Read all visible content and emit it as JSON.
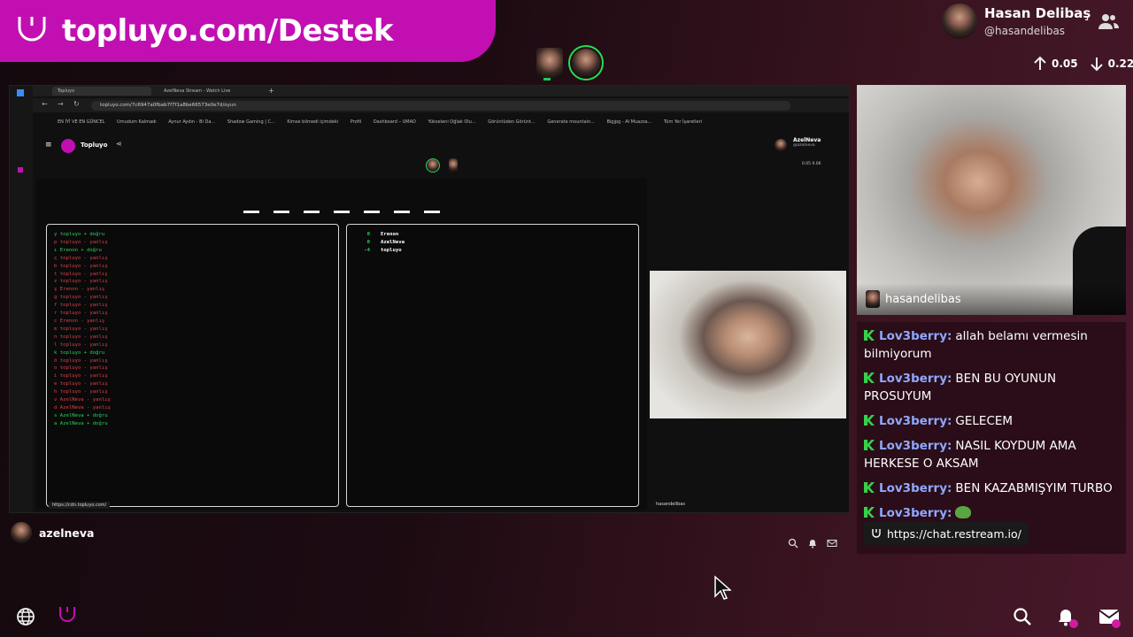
{
  "banner": {
    "text": "topluyo.com/Destek"
  },
  "profile": {
    "name": "Hasan Delibaş",
    "handle": "@hasandelibas"
  },
  "stats": {
    "up": "0.05",
    "down": "0.22"
  },
  "browser": {
    "tabs": [
      "Topluyo",
      "AzelNeva Stream - Watch Live"
    ],
    "url": "topluyo.com/7c6947a0fbab7f7f1a8be66573e0e7d/oyun",
    "bookmarks": [
      "EN İYİ VE EN GÜNCEL",
      "Umudum Kalmadı",
      "Aynur Aydın - Bi Da...",
      "Shadow Gaming | C...",
      "Kimse bilmedi içimdeki",
      "Profil",
      "Dashboard – UMAO",
      "Yükseleni Oğlak Olu...",
      "Görüntüden Görünt...",
      "Generate mountain...",
      "Bigjpg - AI Muazza...",
      "Tüm Yer İşaretleri"
    ],
    "site_title": "Topluyo",
    "inner_name": "AzelNeva",
    "inner_handle": "@azelneva",
    "inner_stats": "0.05  0.06",
    "status_url": "https://cdn.topluyo.com/",
    "host_label": "hasandelibas"
  },
  "game": {
    "log": [
      {
        "t": "y topluyo + doğru",
        "c": "gr"
      },
      {
        "t": "p topluyo - yanlış",
        "c": "rd"
      },
      {
        "t": "ı Erenon + doğru",
        "c": "gr"
      },
      {
        "t": "ç topluyo - yanlış",
        "c": "rd"
      },
      {
        "t": "b topluyo - yanlış",
        "c": "rd"
      },
      {
        "t": "t topluyo - yanlış",
        "c": "rd"
      },
      {
        "t": "z topluyo - yanlış",
        "c": "rd"
      },
      {
        "t": "ş Erenon - yanlış",
        "c": "rd"
      },
      {
        "t": "g topluyo - yanlış",
        "c": "rd"
      },
      {
        "t": "f topluyo - yanlış",
        "c": "rd"
      },
      {
        "t": "r topluyo - yanlış",
        "c": "rd"
      },
      {
        "t": "c Erenon - yanlış",
        "c": "rd"
      },
      {
        "t": "m topluyo - yanlış",
        "c": "rd"
      },
      {
        "t": "n topluyo - yanlış",
        "c": "rd"
      },
      {
        "t": "l topluyo - yanlış",
        "c": "rd"
      },
      {
        "t": "k topluyo + doğru",
        "c": "gr"
      },
      {
        "t": "ö topluyo - yanlış",
        "c": "rd"
      },
      {
        "t": "o topluyo - yanlış",
        "c": "rd"
      },
      {
        "t": "i topluyo - yanlış",
        "c": "rd"
      },
      {
        "t": "e topluyo - yanlış",
        "c": "rd"
      },
      {
        "t": "h topluyo - yanlış",
        "c": "rd"
      },
      {
        "t": "v AzelNeva - yanlış",
        "c": "rd"
      },
      {
        "t": "d AzelNeva - yanlış",
        "c": "rd"
      },
      {
        "t": "s AzelNeva + doğru",
        "c": "gr"
      },
      {
        "t": "a AzelNeva + doğru",
        "c": "gr"
      }
    ],
    "scores": [
      {
        "v": "0",
        "n": "Erenon"
      },
      {
        "v": "0",
        "n": "AzelNeva"
      },
      {
        "v": "-4",
        "n": "topluyo"
      }
    ]
  },
  "cam_label": "hasandelibas",
  "chat": [
    {
      "u": "Lov3berry:",
      "m": "allah belamı vermesin bilmiyorum"
    },
    {
      "u": "Lov3berry:",
      "m": "BEN BU OYUNUN PROSUYUM"
    },
    {
      "u": "Lov3berry:",
      "m": "GELECEM"
    },
    {
      "u": "Lov3berry:",
      "m": "NASIL KOYDUM AMA HERKESE O AKSAM"
    },
    {
      "u": "Lov3berry:",
      "m": "BEN KAZABMIŞYIM TURBO"
    },
    {
      "u": "Lov3berry:",
      "m": ""
    },
    {
      "u": "Lov3berry:",
      "m": ""
    }
  ],
  "restream_link": "https://chat.restream.io/",
  "bottom_user": "azelneva",
  "colors": {
    "brand": "#c20fb2",
    "online": "#20e050",
    "chat_user": "#8fa8ff"
  }
}
